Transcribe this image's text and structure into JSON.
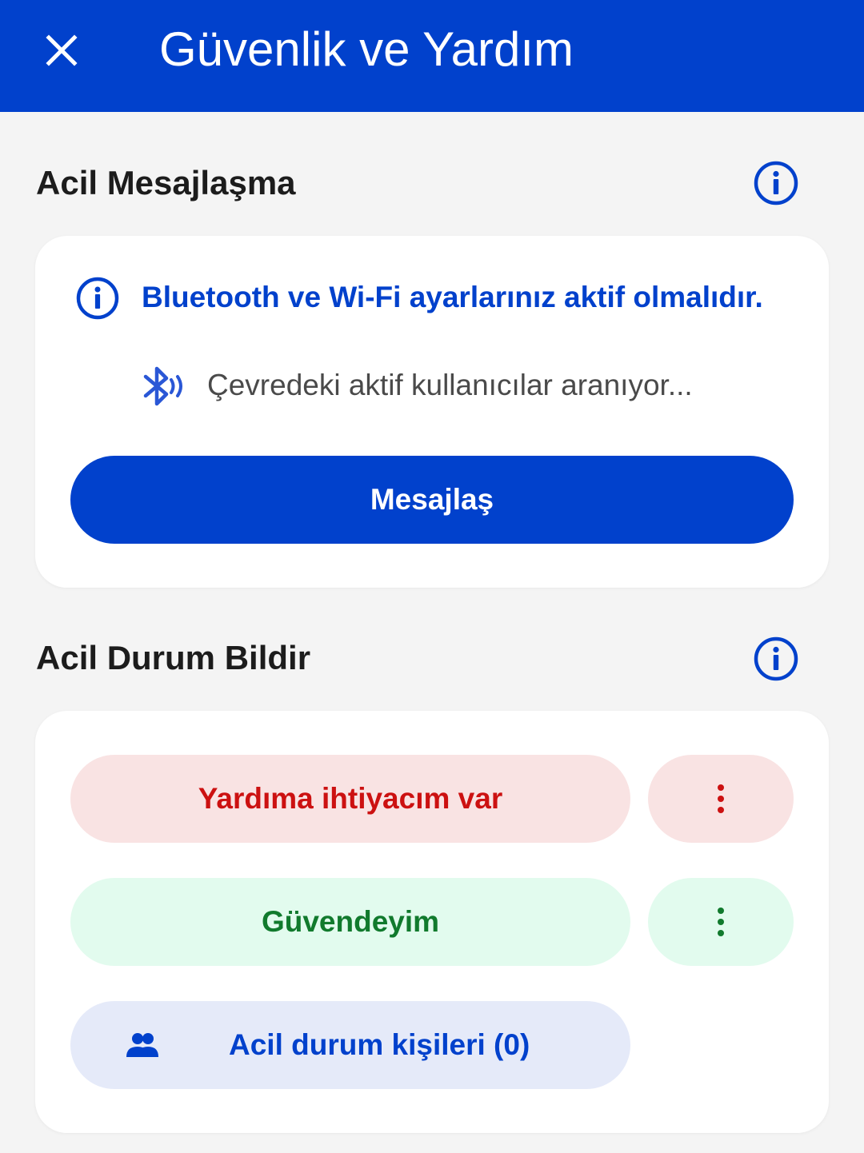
{
  "header": {
    "title": "Güvenlik ve Yardım",
    "close_icon": "close-icon",
    "background_color": "#0141cc"
  },
  "messaging": {
    "title": "Acil Mesajlaşma",
    "info_icon": "info-icon",
    "notice": "Bluetooth ve Wi-Fi ayarlarınız aktif olmalıdır.",
    "searching_icon": "bluetooth-searching-icon",
    "searching_text": "Çevredeki aktif kullanıcılar aranıyor...",
    "button_label": "Mesajlaş"
  },
  "emergency": {
    "title": "Acil Durum Bildir",
    "info_icon": "info-icon",
    "need_help": {
      "label": "Yardıma ihtiyacım var",
      "text_color": "#cc1111",
      "bg_color": "#f9e3e3",
      "more_icon": "more-vertical-icon"
    },
    "safe": {
      "label": "Güvendeyim",
      "text_color": "#117a2d",
      "bg_color": "#e2fbee",
      "more_icon": "more-vertical-icon"
    },
    "contacts": {
      "label": "Acil durum kişileri (0)",
      "icon": "people-icon",
      "text_color": "#0141cc",
      "bg_color": "#e5eaf9"
    }
  }
}
